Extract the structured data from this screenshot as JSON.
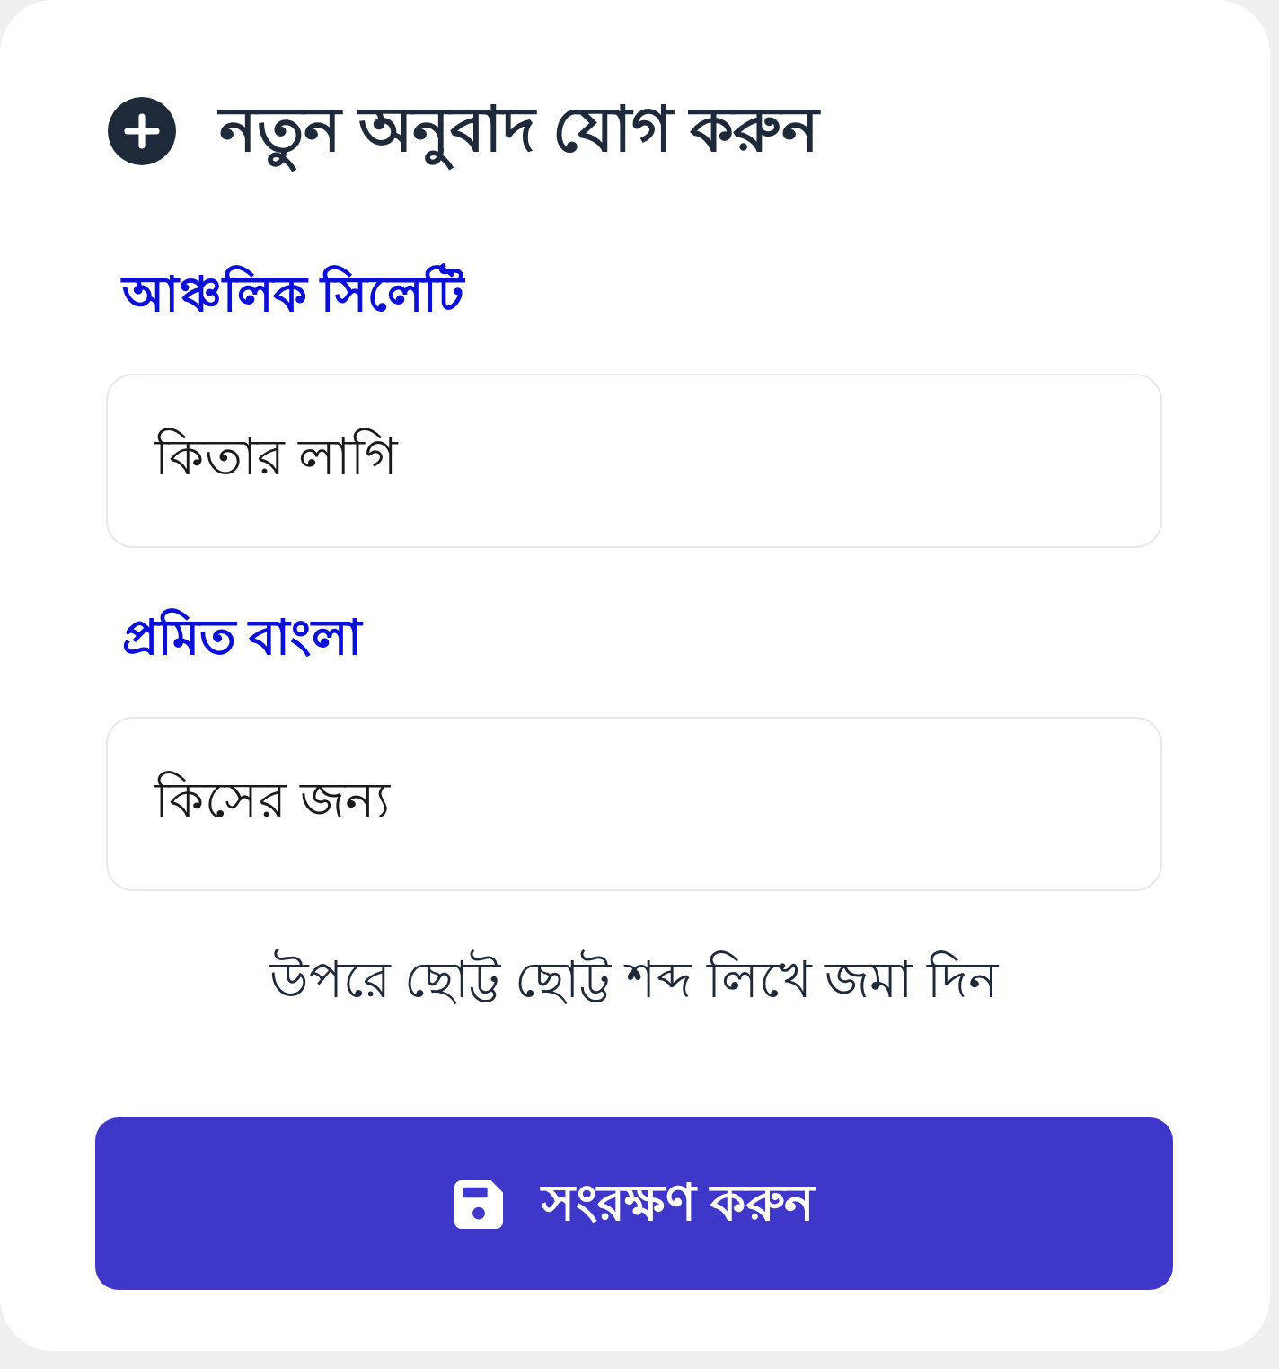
{
  "card": {
    "title": "নতুন অনুবাদ যোগ করুন",
    "fields": [
      {
        "label": "আঞ্চলিক সিলেটি",
        "value": "কিতার লাগি"
      },
      {
        "label": "প্রমিত বাংলা",
        "value": "কিসের জন্য"
      }
    ],
    "hint": "উপরে ছোট্ট ছোট্ট শব্দ লিখে জমা দিন",
    "save_button": {
      "label": "সংরক্ষণ করুন"
    }
  }
}
